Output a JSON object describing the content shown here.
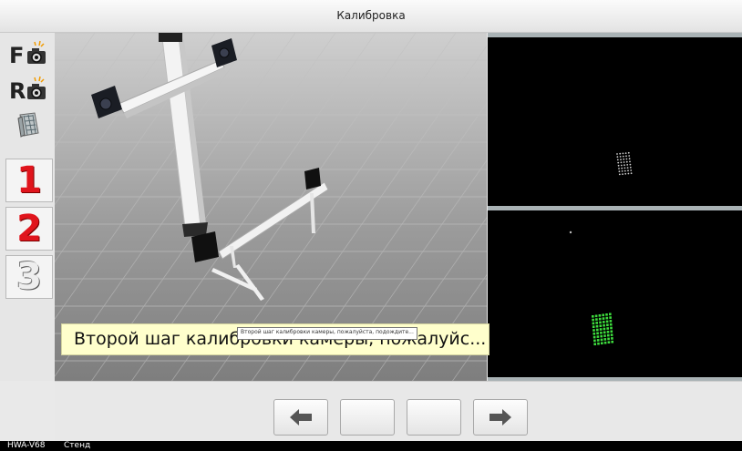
{
  "window": {
    "title": "Калибровка"
  },
  "toolbar": {
    "front_camera": {
      "letter": "F",
      "icon": "front-camera-icon"
    },
    "rear_camera": {
      "letter": "R",
      "icon": "rear-camera-icon"
    },
    "calibration_tool": {
      "icon": "grid-tool-icon"
    },
    "steps": [
      {
        "label": "1",
        "state": "active"
      },
      {
        "label": "2",
        "state": "active"
      },
      {
        "label": "3",
        "state": "inactive"
      }
    ]
  },
  "banner": {
    "text": "Второй шаг калибровки камеры, пожалуйс..."
  },
  "tooltip": {
    "text": "Второй шаг калибровки камеры, пожалуйста, подождите..."
  },
  "navigation": {
    "back": {
      "icon": "arrow-left-icon"
    },
    "forward": {
      "icon": "arrow-right-icon"
    }
  },
  "status_bar": {
    "model": "HWA-V68",
    "mode": "Стенд"
  },
  "colors": {
    "target_green": "#3ddc3d",
    "banner_bg": "#ffffcc",
    "step_red": "#e0141c"
  }
}
